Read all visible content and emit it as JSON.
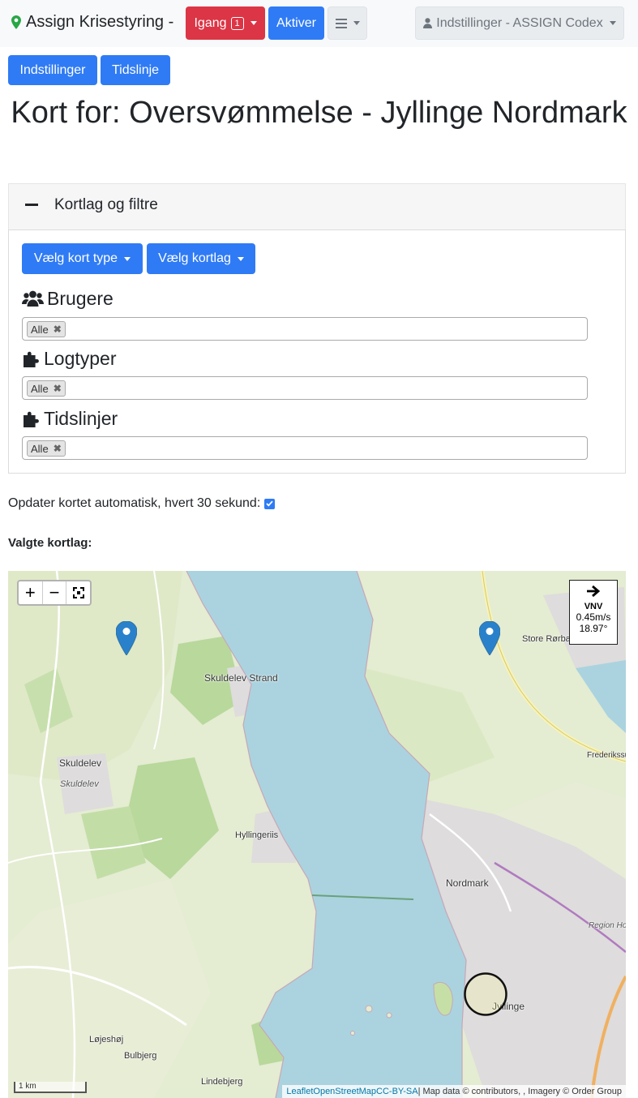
{
  "navbar": {
    "brand": "Assign Krisestyring -",
    "status_label": "Igang",
    "status_count": "1",
    "activate_label": "Aktiver",
    "settings_label": "Indstillinger - ASSIGN Codex"
  },
  "toolbar": {
    "settings_button": "Indstillinger",
    "timeline_button": "Tidslinje"
  },
  "page_title": "Kort for: Oversvømmelse - Jyllinge Nordmark",
  "accordion": {
    "title": "Kortlag og filtre",
    "map_type_button": "Vælg kort type",
    "map_layer_button": "Vælg kortlag",
    "sections": [
      {
        "title": "Brugere",
        "tag": "Alle"
      },
      {
        "title": "Logtyper",
        "tag": "Alle"
      },
      {
        "title": "Tidslinjer",
        "tag": "Alle"
      }
    ]
  },
  "auto_update_label": "Opdater kortet automatisk, hvert 30 sekund:",
  "auto_update_checked": true,
  "selected_layers_label": "Valgte kortlag:",
  "map": {
    "zoom_in": "+",
    "zoom_out": "−",
    "wind": {
      "direction": "VNV",
      "speed": "0.45m/s",
      "degrees": "18.97°"
    },
    "scale": "1 km",
    "attribution": {
      "leaflet": "Leaflet",
      "osm": "OpenStreetMap",
      "license": "CC-BY-SA",
      "rest": "| Map data © contributors, , Imagery © Order Group"
    },
    "labels": {
      "skuldelev_strand": "Skuldelev Strand",
      "skuldelev": "Skuldelev",
      "skuldelev_it": "Skuldelev",
      "hyllingeriis": "Hyllingeriis",
      "nordmark": "Nordmark",
      "jyllinge": "Jyllinge",
      "store_rorbaek": "Store Rørbæ",
      "lojeshoj": "Løjeshøj",
      "bulbjerg": "Bulbjerg",
      "lindebjerg": "Lindebjerg",
      "frederikssund": "Frederikssu",
      "region": "Region Ho"
    }
  },
  "colors": {
    "primary": "#2f7bf5",
    "danger": "#dc3545",
    "water": "#aad3df",
    "marker": "#2a81cb"
  }
}
